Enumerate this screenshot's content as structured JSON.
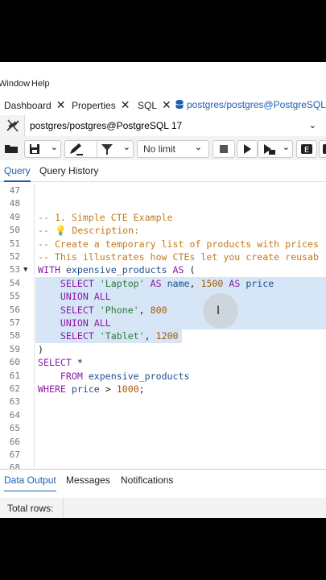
{
  "menubar": {
    "window": "Window",
    "help": "Help"
  },
  "tabs": [
    {
      "label": "Dashboard"
    },
    {
      "label": "Properties"
    },
    {
      "label": "SQL"
    },
    {
      "label": "postgres/postgres@PostgreSQL"
    }
  ],
  "connection": {
    "label": "postgres/postgres@PostgreSQL 17"
  },
  "toolbar": {
    "limit": "No limit"
  },
  "query_tabs": {
    "query": "Query",
    "history": "Query History"
  },
  "editor": {
    "lines": [
      {
        "n": "47",
        "t": ""
      },
      {
        "n": "48",
        "t": ""
      },
      {
        "n": "49",
        "t": "-- 1. Simple CTE Example"
      },
      {
        "n": "50",
        "t": "-- 💡 Description:"
      },
      {
        "n": "51",
        "t": "-- Create a temporary list of products with prices"
      },
      {
        "n": "52",
        "t": "-- This illustrates how CTEs let you create reusab"
      },
      {
        "n": "53",
        "t": "WITH expensive_products AS ("
      },
      {
        "n": "54",
        "t": "    SELECT 'Laptop' AS name, 1500 AS price"
      },
      {
        "n": "55",
        "t": "    UNION ALL"
      },
      {
        "n": "56",
        "t": "    SELECT 'Phone', 800"
      },
      {
        "n": "57",
        "t": "    UNION ALL"
      },
      {
        "n": "58",
        "t": "    SELECT 'Tablet', 1200"
      },
      {
        "n": "59",
        "t": ")"
      },
      {
        "n": "60",
        "t": "SELECT *"
      },
      {
        "n": "61",
        "t": "    FROM expensive_products"
      },
      {
        "n": "62",
        "t": "WHERE price > 1000;"
      },
      {
        "n": "63",
        "t": ""
      },
      {
        "n": "64",
        "t": ""
      },
      {
        "n": "65",
        "t": ""
      },
      {
        "n": "66",
        "t": ""
      },
      {
        "n": "67",
        "t": ""
      },
      {
        "n": "68",
        "t": ""
      }
    ]
  },
  "bottom_tabs": {
    "data_output": "Data Output",
    "messages": "Messages",
    "notifications": "Notifications"
  },
  "status": {
    "total_rows": "Total rows:"
  },
  "colors": {
    "accent": "#1a5fb4",
    "selection": "#d6e6f7",
    "comment": "#c47a1b",
    "keyword": "#8b1aa8"
  }
}
